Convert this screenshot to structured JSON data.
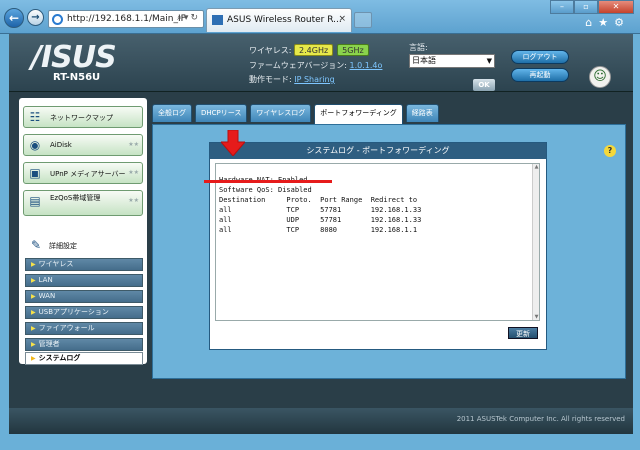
{
  "browser": {
    "url": "http://192.168.1.1/Main_IF",
    "tab_title": "ASUS Wireless Router R...",
    "tab_close": "×"
  },
  "header": {
    "brand": "/ISUS",
    "model": "RT-N56U",
    "wireless_label": "ワイヤレス:",
    "band_24": "2.4GHz",
    "band_5": "5GHz",
    "firmware_label": "ファームウェアバージョン:",
    "firmware_version": "1.0.1.4o",
    "mode_label": "動作モード:",
    "mode_value": "IP Sharing",
    "lang_label": "言語:",
    "lang_value": "日本語",
    "ok": "OK",
    "logout": "ログアウト",
    "reboot": "再起動"
  },
  "sidebar": {
    "items": [
      {
        "label": "ネットワークマップ"
      },
      {
        "label": "AiDisk"
      },
      {
        "label": "UPnP メディアサーバー"
      },
      {
        "label": "EzQoS帯域管理"
      }
    ],
    "section": "詳細設定",
    "subitems": [
      {
        "label": "ワイヤレス"
      },
      {
        "label": "LAN"
      },
      {
        "label": "WAN"
      },
      {
        "label": "USBアプリケーション"
      },
      {
        "label": "ファイアウォール"
      },
      {
        "label": "管理者"
      },
      {
        "label": "システムログ"
      }
    ]
  },
  "main": {
    "tabs": [
      {
        "label": "全般ログ"
      },
      {
        "label": "DHCPリース"
      },
      {
        "label": "ワイヤレスログ"
      },
      {
        "label": "ポートフォワーディング"
      },
      {
        "label": "経路表"
      }
    ],
    "active_tab": 3,
    "log_title": "システムログ - ポートフォワーディング",
    "log_lines": [
      "Hardware NAT: Enabled",
      "Software QoS: Disabled",
      "Destination     Proto.  Port Range  Redirect to",
      "all             TCP     57781       192.168.1.33",
      "all             UDP     57781       192.168.1.33",
      "all             TCP     8080        192.168.1.1"
    ],
    "refresh": "更新",
    "help": "?"
  },
  "footer": {
    "copyright": "2011 ASUSTek Computer Inc. All rights reserved"
  },
  "colors": {
    "page_bg": "#6ab0d8",
    "annotation_red": "#e61b1b"
  }
}
